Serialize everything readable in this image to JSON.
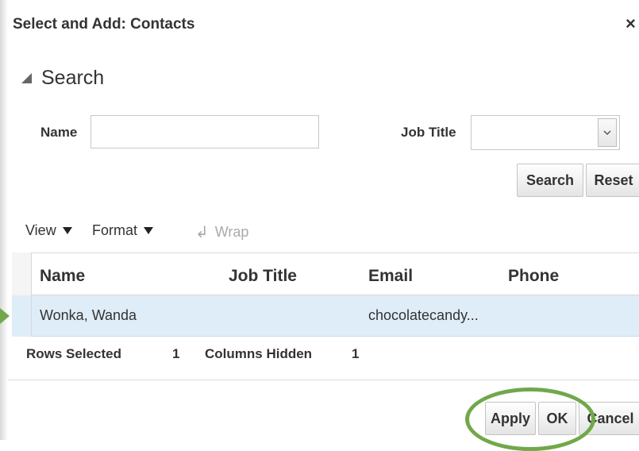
{
  "dialog": {
    "title": "Select and Add: Contacts",
    "close_glyph": "×"
  },
  "search": {
    "header": "Search",
    "name_label": "Name",
    "name_value": "",
    "job_title_label": "Job Title",
    "job_title_value": "",
    "search_button": "Search",
    "reset_button": "Reset"
  },
  "toolbar": {
    "view": "View",
    "format": "Format",
    "wrap": "Wrap"
  },
  "table": {
    "columns": [
      "Name",
      "Job Title",
      "Email",
      "Phone"
    ],
    "rows": [
      {
        "name": "Wonka, Wanda",
        "job_title": "",
        "email": "chocolatecandy...",
        "phone": ""
      }
    ]
  },
  "status": {
    "rows_selected_label": "Rows Selected",
    "rows_selected_value": "1",
    "columns_hidden_label": "Columns Hidden",
    "columns_hidden_value": "1"
  },
  "footer": {
    "apply": "Apply",
    "ok": "OK",
    "cancel": "Cancel"
  },
  "colors": {
    "accent_highlight": "#71a84a",
    "selected_row": "#dfedf8"
  },
  "icons": [
    "close-icon",
    "collapse-triangle-icon",
    "dropdown-chevron-icon",
    "caret-down-icon",
    "wrap-icon",
    "row-arrow-icon"
  ]
}
